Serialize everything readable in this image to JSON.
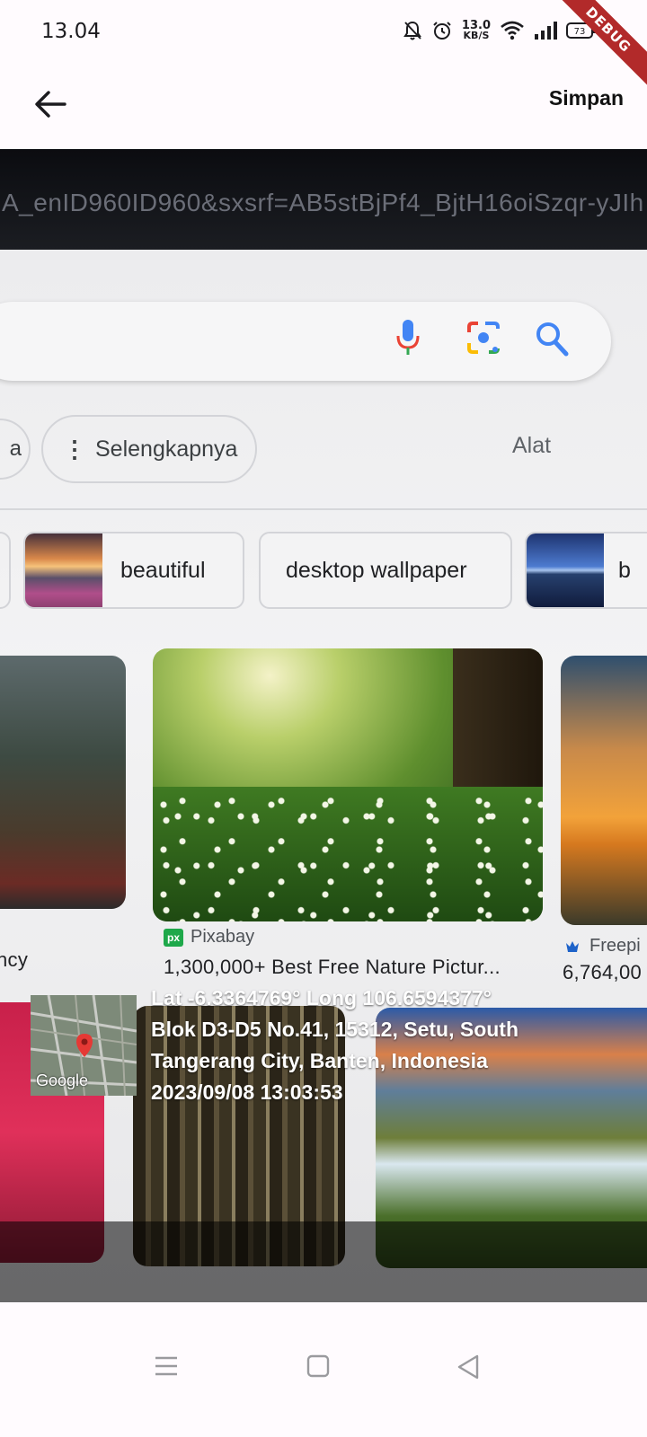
{
  "status_bar": {
    "time": "13.04",
    "net_speed_value": "13.0",
    "net_speed_unit": "KB/S",
    "icons": [
      "mute-bell-icon",
      "alarm-icon",
      "wifi-icon",
      "signal-icon",
      "battery-icon"
    ]
  },
  "debug_banner": "DEBUG",
  "app_bar": {
    "back_icon": "arrow-back-icon",
    "save_label": "Simpan"
  },
  "photo": {
    "url_text": "A_enID960ID960&sxsrf=AB5stBjPf4_BjtH16oiSzqr-yJIh",
    "search_icons": [
      "mic-icon",
      "camera-lens-icon",
      "search-icon"
    ],
    "chip_cut_label": "a",
    "more_chip_label": "Selengkapnya",
    "tools_label": "Alat",
    "related_chips": [
      {
        "label": "beautiful"
      },
      {
        "label": "desktop wallpaper"
      },
      {
        "label": "b"
      }
    ],
    "results": [
      {
        "source": "",
        "title": "ncy"
      },
      {
        "source": "Pixabay",
        "title": "1,300,000+ Best Free Nature Pictur..."
      },
      {
        "source": "Freepi",
        "title": "6,764,00"
      }
    ]
  },
  "geotag": {
    "map_brand": "Google",
    "line1": "Lat -6.3364769° Long 106.6594377°",
    "line2": "Blok D3-D5 No.41, 15312, Setu, South",
    "line3": "Tangerang City, Banten, Indonesia",
    "line4": "2023/09/08 13:03:53"
  },
  "system_nav": {
    "icons": [
      "menu-icon",
      "home-square-icon",
      "back-triangle-icon"
    ]
  },
  "colors": {
    "background": "#fffbfe",
    "debug_banner": "#b22a2a",
    "google_blue": "#4285f4",
    "google_red": "#ea4335",
    "google_yellow": "#fbbc05",
    "google_green": "#34a853"
  }
}
